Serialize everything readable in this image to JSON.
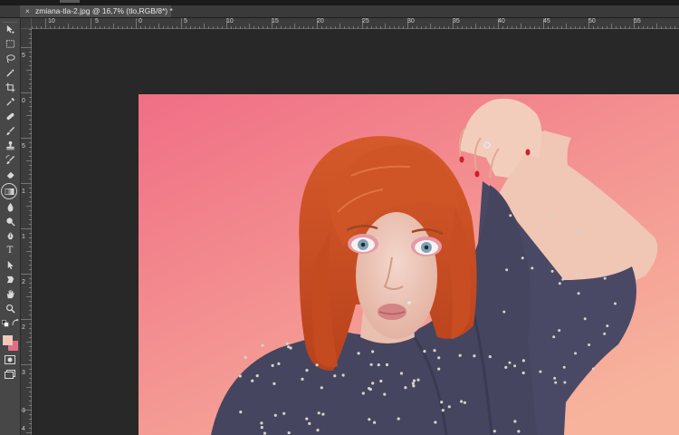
{
  "document_tab": {
    "close_glyph": "×",
    "title": "zmiana-tla-2.jpg @ 16,7% (tlo,RGB/8*) *"
  },
  "rulers": {
    "horizontal_labels": [
      "10",
      "5",
      "0",
      "5",
      "10",
      "15",
      "20",
      "25",
      "30",
      "35",
      "40",
      "45",
      "50",
      "55"
    ],
    "vertical_labels": [
      "5",
      "0",
      "5",
      "1",
      "1",
      "2",
      "2",
      "3",
      "3",
      "4"
    ]
  },
  "toolbar": {
    "tools": [
      {
        "name": "move-tool",
        "icon": "move-icon"
      },
      {
        "name": "marquee-tool",
        "icon": "marquee-icon"
      },
      {
        "name": "lasso-tool",
        "icon": "lasso-icon"
      },
      {
        "name": "quick-selection-tool",
        "icon": "magic-wand-icon"
      },
      {
        "name": "crop-tool",
        "icon": "crop-icon"
      },
      {
        "name": "eyedropper-tool",
        "icon": "eyedropper-icon"
      },
      {
        "name": "healing-brush-tool",
        "icon": "bandage-icon"
      },
      {
        "name": "brush-tool",
        "icon": "brush-icon"
      },
      {
        "name": "clone-stamp-tool",
        "icon": "stamp-icon"
      },
      {
        "name": "history-brush-tool",
        "icon": "history-brush-icon"
      },
      {
        "name": "eraser-tool",
        "icon": "eraser-icon"
      },
      {
        "name": "gradient-tool",
        "icon": "gradient-icon",
        "selected": true
      },
      {
        "name": "blur-tool",
        "icon": "droplet-icon"
      },
      {
        "name": "dodge-tool",
        "icon": "dodge-icon"
      },
      {
        "name": "pen-tool",
        "icon": "pen-icon"
      },
      {
        "name": "type-tool",
        "icon": "type-icon",
        "label": "T"
      },
      {
        "name": "path-selection-tool",
        "icon": "arrow-icon"
      },
      {
        "name": "shape-tool",
        "icon": "shape-icon"
      },
      {
        "name": "hand-tool",
        "icon": "hand-icon"
      },
      {
        "name": "zoom-tool",
        "icon": "zoom-icon"
      }
    ],
    "foreground_color": "#f7c7b2",
    "background_color": "#e46d86"
  },
  "image": {
    "background_gradient": [
      "#f06e85",
      "#f7b39c"
    ]
  }
}
